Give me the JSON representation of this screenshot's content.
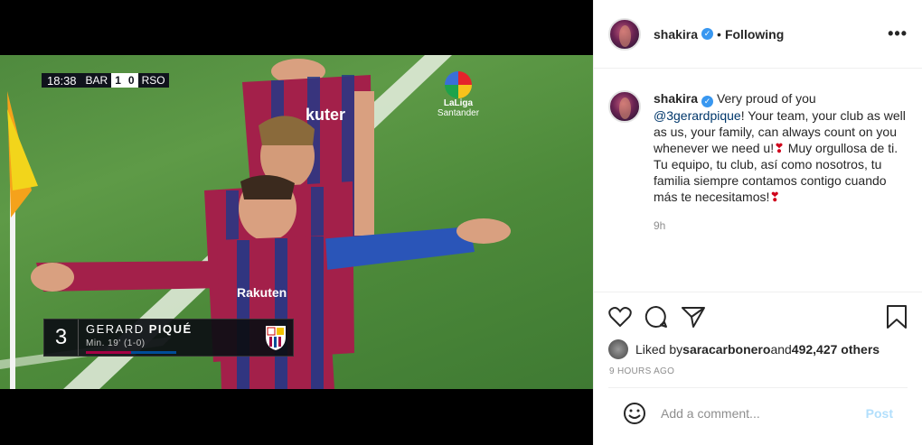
{
  "media": {
    "scorebug": {
      "clock": "18:38",
      "home": "BAR",
      "home_score": "1",
      "away_score": "0",
      "away": "RSO"
    },
    "league": {
      "line1": "LaLiga",
      "line2": "Santander"
    },
    "lower_third": {
      "number": "3",
      "name_first": "GERARD ",
      "name_last": "PIQUÉ",
      "minute": "Min. 19' (1-0)"
    }
  },
  "header": {
    "username": "shakira",
    "separator": "•",
    "follow_label": "Following",
    "more": "•••"
  },
  "caption": {
    "username": "shakira",
    "text_start": "Very proud of you",
    "mention": "@3gerardpique",
    "text_1": "! Your team, your club as well as us, your family, can always count on you whenever we need u!",
    "text_2": " Muy orgullosa de ti. Tu equipo, tu club, así como nosotros, tu familia siempre contamos contigo cuando más te necesitamos!",
    "heart": "❣",
    "time": "9h"
  },
  "actions": {
    "liked_by_prefix": "Liked by ",
    "liked_by_user": "saracarbonero",
    "liked_by_mid": " and ",
    "liked_by_count": "492,427 others",
    "time_ago": "9 HOURS AGO"
  },
  "add_comment": {
    "placeholder": "Add a comment...",
    "post_label": "Post"
  },
  "colors": {
    "link": "#00376b",
    "verified": "#3897f0",
    "post_disabled": "#b2dffc"
  }
}
